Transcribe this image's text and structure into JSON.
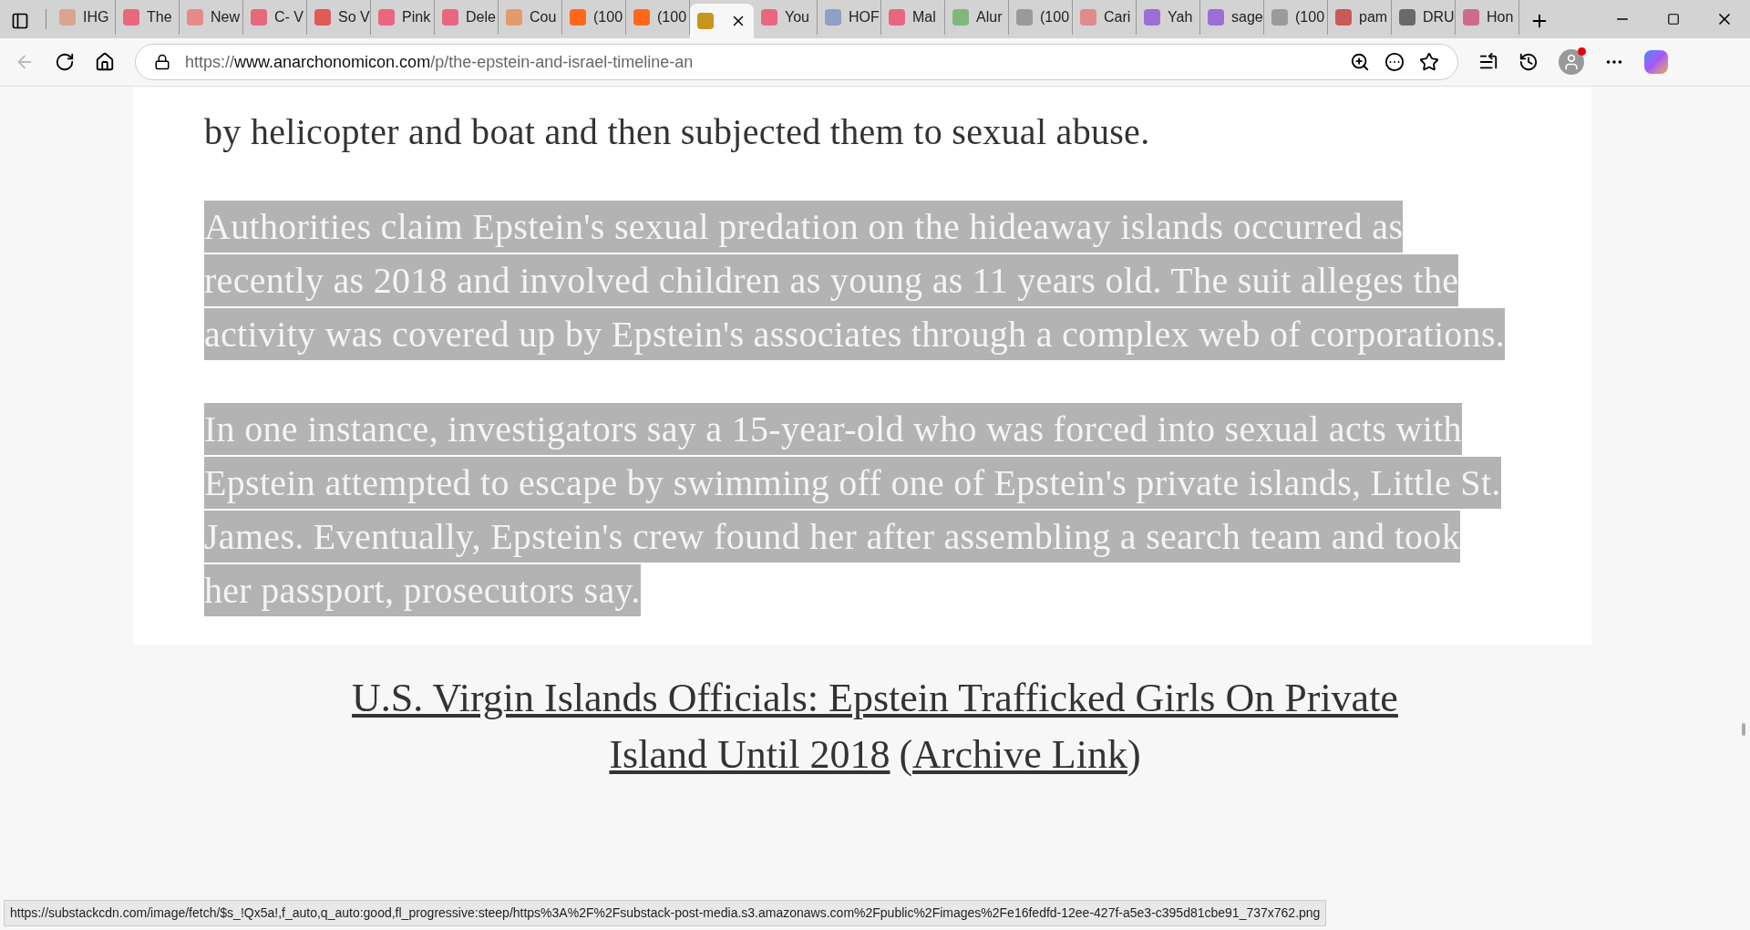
{
  "tabs": [
    {
      "label": "IHG",
      "color": "#d9a58c",
      "selected": false
    },
    {
      "label": "The",
      "color": "#e8677f",
      "selected": false
    },
    {
      "label": "New",
      "color": "#e58a8a",
      "selected": false
    },
    {
      "label": "C- V",
      "color": "#e8677f",
      "selected": false
    },
    {
      "label": "So V",
      "color": "#e05a5a",
      "selected": false
    },
    {
      "label": "Pink",
      "color": "#e8677f",
      "selected": false
    },
    {
      "label": "Dele",
      "color": "#e8677f",
      "selected": false
    },
    {
      "label": "Cou",
      "color": "#e49a6a",
      "selected": false
    },
    {
      "label": "(100",
      "color": "#ff6719",
      "selected": false
    },
    {
      "label": "(100",
      "color": "#ff6719",
      "selected": false
    },
    {
      "color": "#c8961e",
      "selected": true
    },
    {
      "label": "You",
      "color": "#e8677f",
      "selected": false
    },
    {
      "label": "HOF",
      "color": "#8fa0c0",
      "selected": false
    },
    {
      "label": "Mal",
      "color": "#e8677f",
      "selected": false
    },
    {
      "label": "Alur",
      "color": "#7fb77e",
      "selected": false
    },
    {
      "label": "(100",
      "color": "#9a9a9a",
      "selected": false
    },
    {
      "label": "Cari",
      "color": "#e08a8a",
      "selected": false
    },
    {
      "label": "Yah",
      "color": "#9b6fd6",
      "selected": false
    },
    {
      "label": "sage",
      "color": "#9b6fd6",
      "selected": false
    },
    {
      "label": "(100",
      "color": "#9a9a9a",
      "selected": false
    },
    {
      "label": "pam",
      "color": "#c85a5a",
      "selected": false
    },
    {
      "label": "DRU",
      "color": "#6a6a6a",
      "selected": false
    },
    {
      "label": "Hon",
      "color": "#d06a8a",
      "selected": false
    }
  ],
  "address_bar": {
    "url_prefix": "https://",
    "url_host": "www.anarchonomicon.com",
    "url_path": "/p/the-epstein-and-israel-timeline-an"
  },
  "article": {
    "paragraphs": [
      {
        "text": "by helicopter and boat and then subjected them to sexual abuse.",
        "highlighted": false
      },
      {
        "text": "Authorities claim Epstein's sexual predation on the hideaway islands occurred as recently as 2018 and involved children as young as 11 years old. The suit alleges the activity was covered up by Epstein's associates through a complex web of corporations.",
        "highlighted": true
      },
      {
        "text": "In one instance, investigators say a 15-year-old who was forced into sexual acts with Epstein attempted to escape by swimming off one of Epstein's private islands, Little St. James. Eventually, Epstein's crew found her after assembling a search team and took her passport, prosecutors say.",
        "highlighted": true
      }
    ]
  },
  "caption": {
    "link_lines": [
      "U.S. Virgin Islands Officials: Epstein Trafficked Girls On Private",
      "Island Until 2018"
    ],
    "open_paren": "(",
    "archive_link": "Archive Link",
    "close_paren": ")"
  },
  "status_bar": {
    "url": "https://substackcdn.com/image/fetch/$s_!Qx5a!,f_auto,q_auto:good,fl_progressive:steep/https%3A%2F%2Fsubstack-post-media.s3.amazonaws.com%2Fpublic%2Fimages%2Fe16fedfd-12ee-427f-a5e3-c395d81cbe91_737x762.png"
  }
}
